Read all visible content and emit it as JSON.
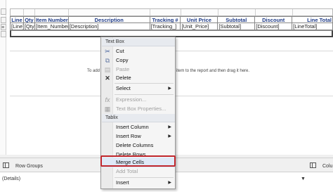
{
  "table": {
    "headers": [
      "Line",
      "Qty",
      "Item Number",
      "Description",
      "Tracking #",
      "Unit Price",
      "Subtotal",
      "Discount",
      "Line Total"
    ],
    "details": [
      "[Line]",
      "[Qty]",
      "[Item_Number]",
      "[Description]",
      "[Tracking_]",
      "[Unit_Price]",
      "[Subtotal]",
      "[Discount]",
      "[LineTotal]"
    ]
  },
  "surface": {
    "drop_text_left": "To add",
    "drop_text_right": "item to the report and then drag it here."
  },
  "context_menu": {
    "section_textbox": "Text Box",
    "cut": "Cut",
    "copy": "Copy",
    "paste": "Paste",
    "delete": "Delete",
    "select": "Select",
    "expression": "Expression...",
    "textbox_properties": "Text Box Properties...",
    "section_tablix": "Tablix",
    "insert_column": "Insert Column",
    "insert_row": "Insert Row",
    "delete_columns": "Delete Columns",
    "delete_rows": "Delete Rows",
    "merge_cells": "Merge Cells",
    "add_total": "Add Total",
    "insert": "Insert"
  },
  "groups": {
    "row_groups_label": "Row Groups",
    "column_groups_label": "Colu",
    "details_item": "(Details)"
  },
  "colors": {
    "header_text": "#1f3b86",
    "highlight_border": "#c0272d",
    "menu_background": "#f5f5f5"
  }
}
